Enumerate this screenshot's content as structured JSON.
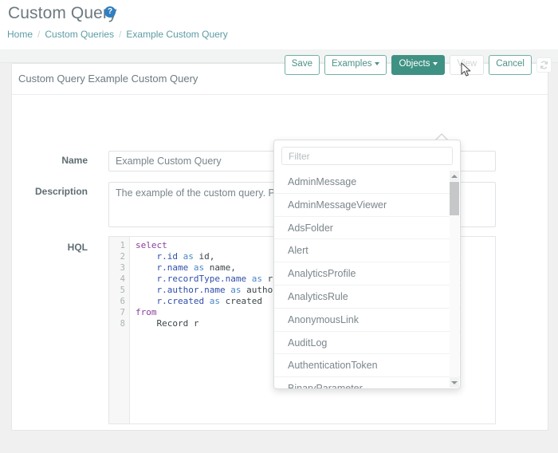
{
  "page": {
    "title": "Custom Query",
    "help_icon_glyph": "?",
    "breadcrumb": [
      {
        "label": "Home"
      },
      {
        "label": "Custom Queries"
      },
      {
        "label": "Example Custom Query"
      }
    ],
    "breadcrumb_separator": "/"
  },
  "card": {
    "header_title": "Custom Query Example Custom Query"
  },
  "toolbar": {
    "save_label": "Save",
    "examples_label": "Examples",
    "objects_label": "Objects",
    "view_label": "View",
    "cancel_label": "Cancel",
    "refresh_icon": "refresh-icon"
  },
  "form": {
    "name_label": "Name",
    "name_value": "Example Custom Query",
    "description_label": "Description",
    "description_value": "The example of the custom query. Please use this query to define new report.",
    "hql_label": "HQL"
  },
  "editor": {
    "line_numbers": [
      "1",
      "2",
      "3",
      "4",
      "5",
      "6",
      "7",
      "8"
    ],
    "lines": [
      "select",
      "    r.id as id,",
      "    r.name as name,",
      "    r.recordType.name as recordType,",
      "    r.author.name as author,",
      "    r.created as created",
      "from",
      "    Record r"
    ]
  },
  "dropdown": {
    "filter_placeholder": "Filter",
    "filter_value": "",
    "items": [
      "AdminMessage",
      "AdminMessageViewer",
      "AdsFolder",
      "Alert",
      "AnalyticsProfile",
      "AnalyticsRule",
      "AnonymousLink",
      "AuditLog",
      "AuthenticationToken",
      "BinaryParameter"
    ],
    "scroll_up_icon": "chevron-up-icon",
    "scroll_down_icon": "chevron-down-icon"
  },
  "colors": {
    "accent": "#3f9283",
    "accent_outline": "#73b0a6",
    "breadcrumb": "#5c9ca3",
    "help_blue": "#2f7fc1",
    "text_muted": "#7b868b"
  }
}
